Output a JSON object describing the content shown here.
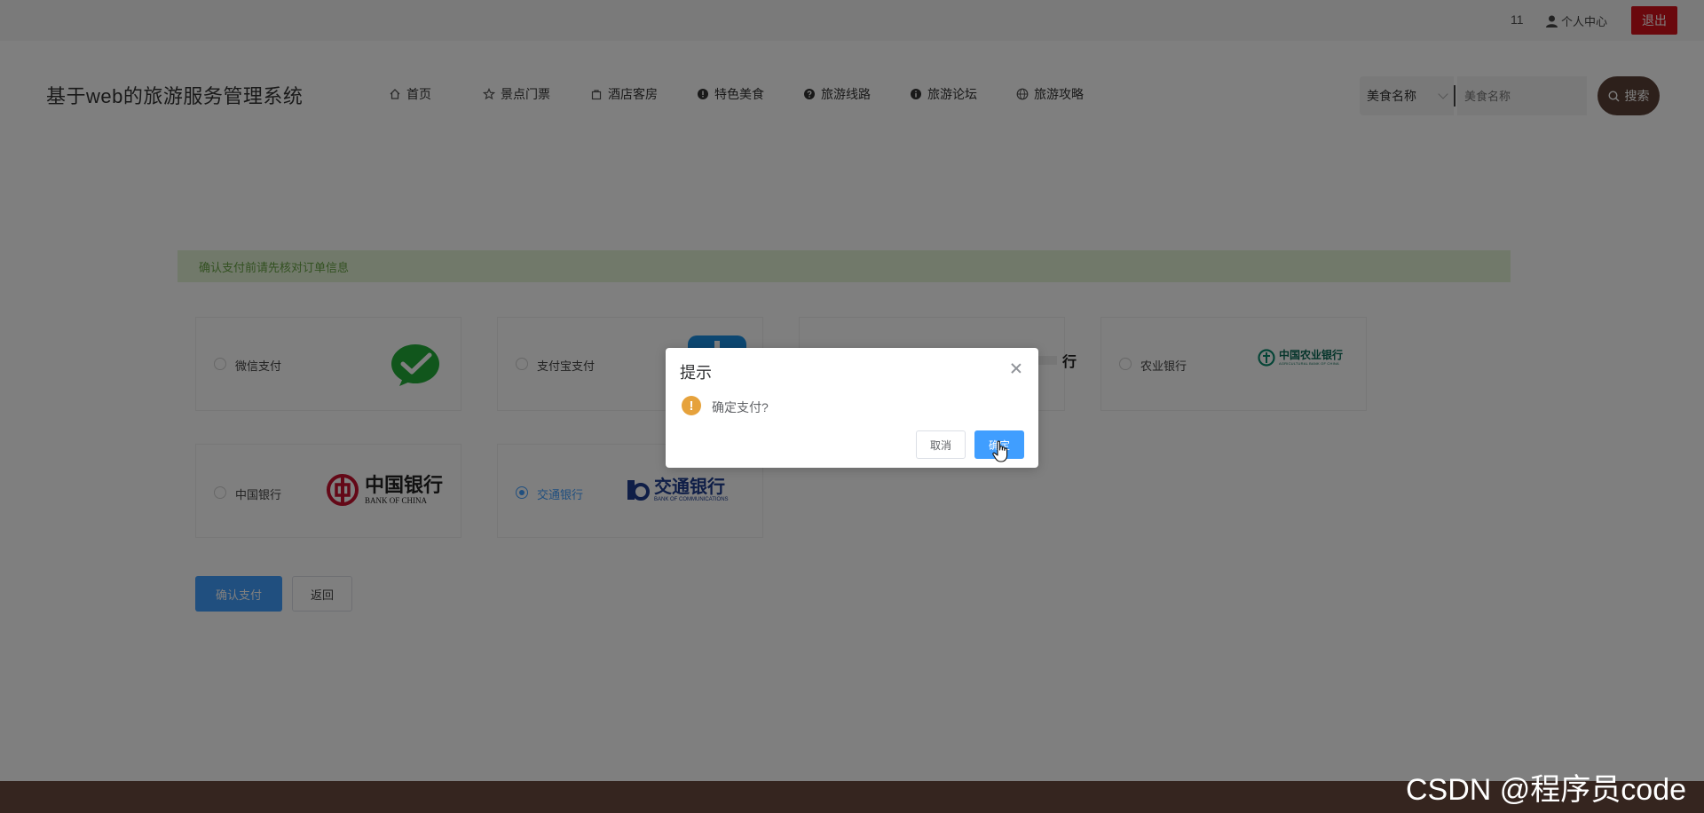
{
  "topbar": {
    "username": "11",
    "user_center": "个人中心",
    "logout": "退出"
  },
  "header": {
    "site_title": "基于web的旅游服务管理系统",
    "nav": [
      {
        "label": "首页",
        "icon": "home-icon"
      },
      {
        "label": "景点门票",
        "icon": "star-icon"
      },
      {
        "label": "酒店客房",
        "icon": "bag-icon"
      },
      {
        "label": "特色美食",
        "icon": "info-circle-icon"
      },
      {
        "label": "旅游线路",
        "icon": "question-circle-icon"
      },
      {
        "label": "旅游论坛",
        "icon": "info-circle-icon"
      },
      {
        "label": "旅游攻略",
        "icon": "globe-icon"
      }
    ],
    "search": {
      "select_value": "美食名称",
      "placeholder": "美食名称",
      "button_label": "搜索"
    }
  },
  "alert": {
    "text": "确认支付前请先核对订单信息"
  },
  "payment": {
    "options": [
      {
        "label": "微信支付",
        "logo": "wechat-pay-logo",
        "checked": false
      },
      {
        "label": "支付宝支付",
        "logo": "alipay-logo",
        "checked": false
      },
      {
        "label": "",
        "logo": "bank-logo",
        "checked": false
      },
      {
        "label": "农业银行",
        "logo": "abc-bank-logo",
        "checked": false
      },
      {
        "label": "中国银行",
        "logo": "bank-of-china-logo",
        "checked": false
      },
      {
        "label": "交通银行",
        "logo": "bank-of-communications-logo",
        "checked": true
      }
    ],
    "logos": {
      "abc_cn": "中国农业银行",
      "abc_en": "AGRICULTURAL BANK OF CHINA",
      "boc_cn": "中国银行",
      "boc_en": "BANK OF CHINA",
      "bocom_cn": "交通银行",
      "bocom_en": "BANK OF COMMUNICATIONS",
      "partial_bank": "行"
    },
    "confirm_button": "确认支付",
    "back_button": "返回"
  },
  "dialog": {
    "title": "提示",
    "message": "确定支付?",
    "cancel": "取消",
    "ok": "确定"
  },
  "watermark": "CSDN @程序员code",
  "colors": {
    "brand_brown": "#5b4037",
    "primary_blue": "#409eff",
    "logout_red": "#d5111a",
    "alert_green": "#67a343",
    "warning_orange": "#e6a23c"
  }
}
